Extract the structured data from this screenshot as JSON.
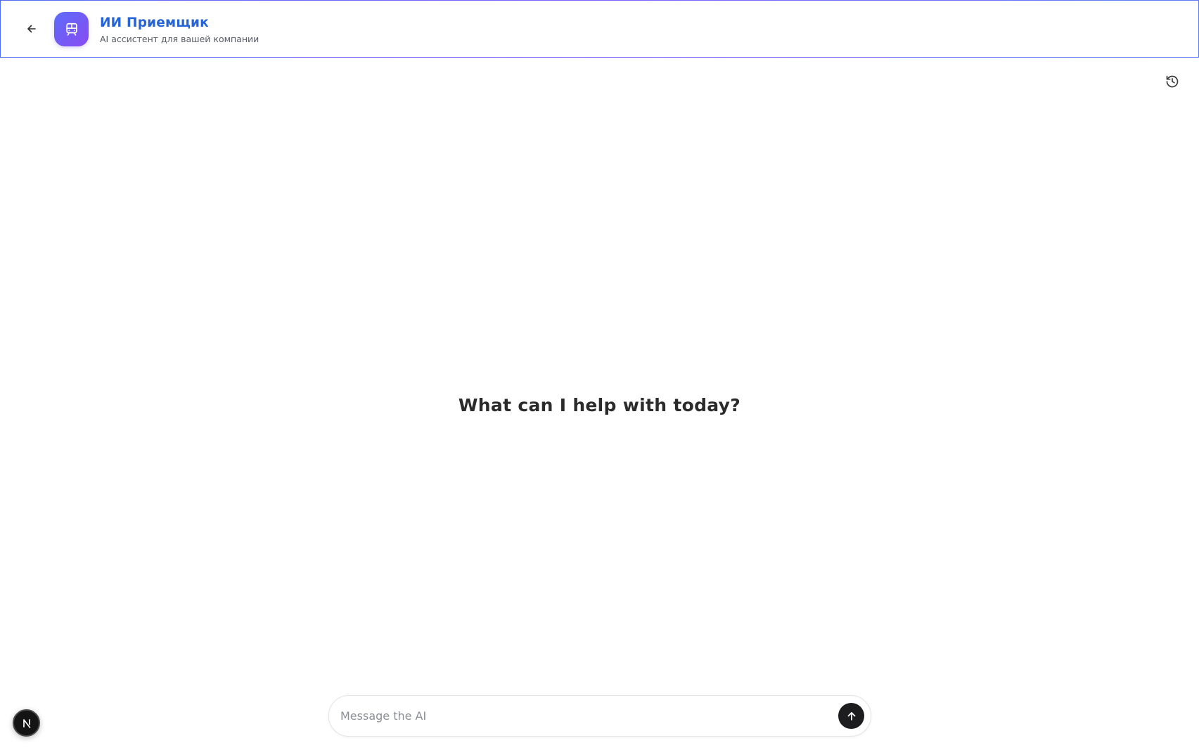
{
  "header": {
    "title": "ИИ Приемщик",
    "subtitle": "AI ассистент для вашей компании",
    "back_icon": "arrow-left-icon",
    "logo_icon": "train-icon"
  },
  "toolbar": {
    "history_icon": "history-icon"
  },
  "main": {
    "welcome": "What can I help with today?"
  },
  "composer": {
    "placeholder": "Message the AI",
    "value": "",
    "send_icon": "arrow-up-icon"
  },
  "badge": {
    "icon": "nextjs-logo-icon"
  },
  "colors": {
    "title": "#2563d9",
    "logo_gradient_start": "#5b6cf9",
    "logo_gradient_end": "#8a4bf2",
    "send_button": "#1d1d1f"
  }
}
